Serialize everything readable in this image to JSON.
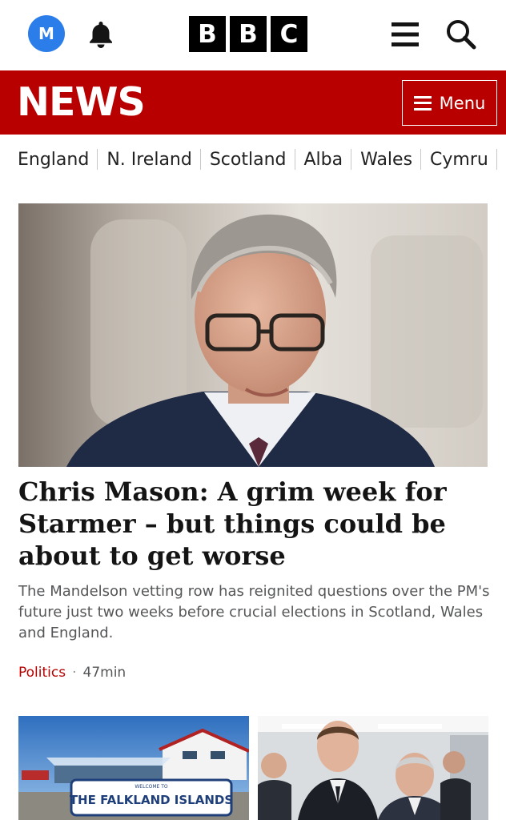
{
  "header": {
    "avatar_letter": "M",
    "bbc_letters": [
      "B",
      "B",
      "C"
    ]
  },
  "newsbar": {
    "brand": "NEWS",
    "menu_label": "Menu"
  },
  "nations": [
    "England",
    "N. Ireland",
    "Scotland",
    "Alba",
    "Wales",
    "Cymru"
  ],
  "hero": {
    "headline": "Chris Mason: A grim week for Starmer – but things could be about to get worse",
    "summary": "The Mandelson vetting row has reignited questions over the PM's future just two weeks before crucial elections in Scotland, Wales and England.",
    "topic": "Politics",
    "separator": "·",
    "time": "47min"
  },
  "cards": [
    {
      "sign_small": "WELCOME TO",
      "sign_text": "THE FALKLAND ISLANDS"
    },
    {}
  ],
  "colors": {
    "brand_red": "#b80000",
    "avatar_blue": "#2b7de9"
  }
}
